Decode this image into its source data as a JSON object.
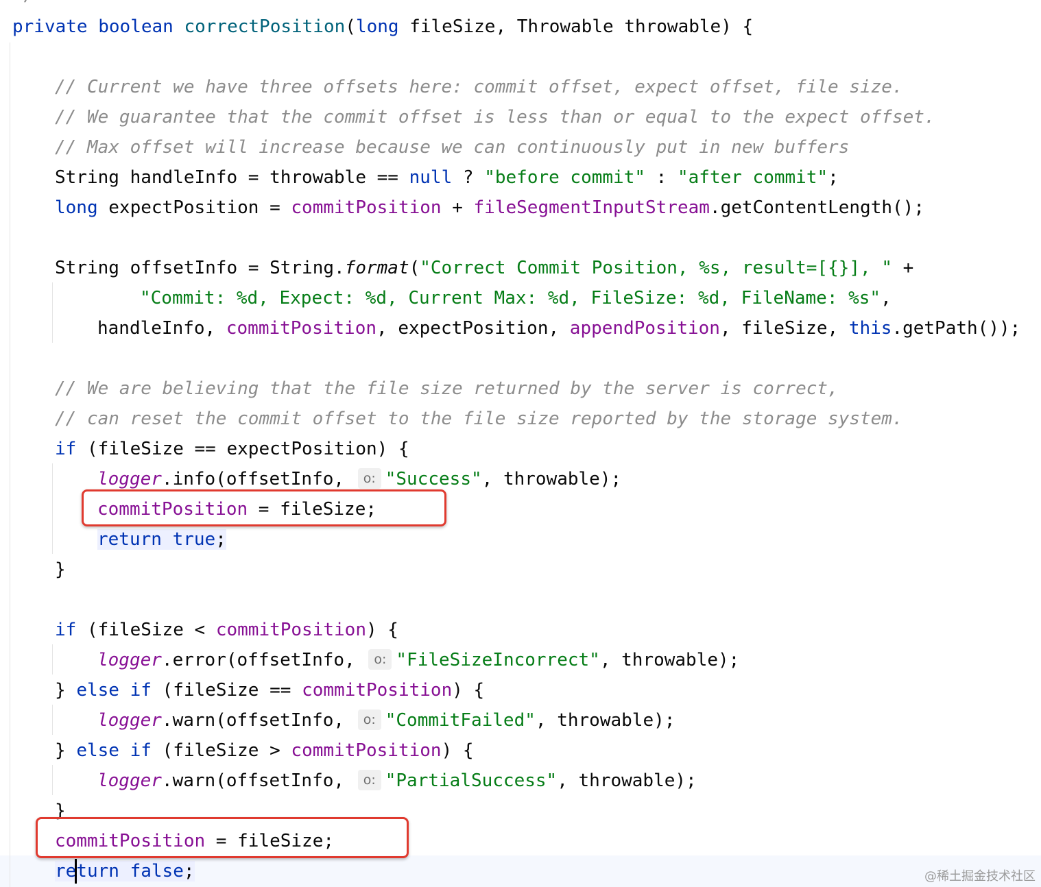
{
  "top_fragment": "*/",
  "method": {
    "modifier": "private",
    "return_type": "boolean",
    "name": "correctPosition",
    "param1_type": "long",
    "param1_name": "fileSize",
    "param2_type": "Throwable",
    "param2_name": "throwable"
  },
  "comments": {
    "c1": "// Current we have three offsets here: commit offset, expect offset, file size.",
    "c2": "// We guarantee that the commit offset is less than or equal to the expect offset.",
    "c3": "// Max offset will increase because we can continuously put in new buffers",
    "c4": "// We are believing that the file size returned by the server is correct,",
    "c5": "// can reset the commit offset to the file size reported by the storage system."
  },
  "strings": {
    "before_commit": "\"before commit\"",
    "after_commit": "\"after commit\"",
    "format1": "\"Correct Commit Position, %s, result=[{}], \"",
    "format2": "\"Commit: %d, Expect: %d, Current Max: %d, FileSize: %d, FileName: %s\"",
    "success": "\"Success\"",
    "filesize_incorrect": "\"FileSizeIncorrect\"",
    "commit_failed": "\"CommitFailed\"",
    "partial_success": "\"PartialSuccess\""
  },
  "identifiers": {
    "handleInfo": "handleInfo",
    "expectPosition": "expectPosition",
    "offsetInfo": "offsetInfo",
    "commitPosition": "commitPosition",
    "appendPosition": "appendPosition",
    "fileSegmentInputStream": "fileSegmentInputStream",
    "getContentLength": "getContentLength",
    "getPath": "getPath",
    "logger": "logger",
    "format": "format",
    "info": "info",
    "error": "error",
    "warn": "warn",
    "String": "String",
    "fileSize": "fileSize",
    "throwable": "throwable"
  },
  "keywords": {
    "String": "String",
    "long": "long",
    "null": "null",
    "if": "if",
    "else": "else",
    "return": "return",
    "true": "true",
    "false": "false",
    "this": "this"
  },
  "param_hint": "o:",
  "highlight_color": "#e03a2f",
  "watermark": "@稀土掘金技术社区"
}
